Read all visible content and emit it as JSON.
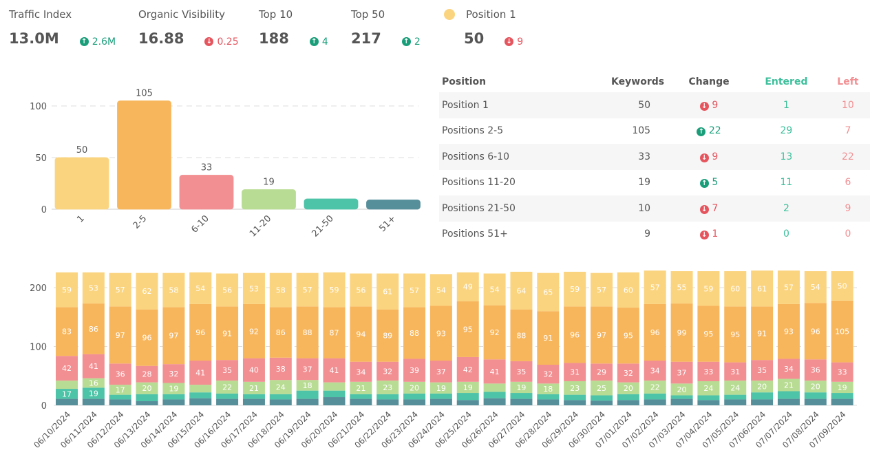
{
  "kpis": [
    {
      "label": "Traffic Index",
      "value": "13.0M",
      "change": "2.6M",
      "dir": "up"
    },
    {
      "label": "Organic Visibility",
      "value": "16.88",
      "change": "0.25",
      "dir": "down"
    },
    {
      "label": "Top 10",
      "value": "188",
      "change": "4",
      "dir": "up"
    },
    {
      "label": "Top 50",
      "value": "217",
      "change": "2",
      "dir": "up"
    },
    {
      "label": "Position 1",
      "value": "50",
      "change": "9",
      "dir": "down",
      "legend_color": "#fbd47f"
    }
  ],
  "table": {
    "headers": [
      "Position",
      "Keywords",
      "Change",
      "Entered",
      "Left"
    ],
    "rows": [
      {
        "position": "Position 1",
        "keywords": "50",
        "change": "9",
        "dir": "down",
        "entered": "1",
        "left": "10"
      },
      {
        "position": "Positions 2-5",
        "keywords": "105",
        "change": "22",
        "dir": "up",
        "entered": "29",
        "left": "7"
      },
      {
        "position": "Positions 6-10",
        "keywords": "33",
        "change": "9",
        "dir": "down",
        "entered": "13",
        "left": "22"
      },
      {
        "position": "Positions 11-20",
        "keywords": "19",
        "change": "5",
        "dir": "up",
        "entered": "11",
        "left": "6"
      },
      {
        "position": "Positions 21-50",
        "keywords": "10",
        "change": "7",
        "dir": "down",
        "entered": "2",
        "left": "9"
      },
      {
        "position": "Positions 51+",
        "keywords": "9",
        "change": "1",
        "dir": "down",
        "entered": "0",
        "left": "0"
      }
    ]
  },
  "chart_data": [
    {
      "type": "bar",
      "categories": [
        "1",
        "2-5",
        "6-10",
        "11-20",
        "21-50",
        "51+"
      ],
      "values": [
        50,
        105,
        33,
        19,
        10,
        9
      ],
      "colors": [
        "#fbd47f",
        "#f8b65c",
        "#f28f92",
        "#b9dc94",
        "#4dc3a7",
        "#568e9a"
      ],
      "ylim": [
        0,
        110
      ],
      "yticks": [
        0,
        50,
        100
      ],
      "grid": true,
      "title": "",
      "xlabel": "",
      "ylabel": ""
    },
    {
      "type": "bar",
      "stacked": true,
      "categories": [
        "06/10/2024",
        "06/11/2024",
        "06/12/2024",
        "06/13/2024",
        "06/14/2024",
        "06/15/2024",
        "06/16/2024",
        "06/17/2024",
        "06/18/2024",
        "06/19/2024",
        "06/20/2024",
        "06/21/2024",
        "06/22/2024",
        "06/23/2024",
        "06/24/2024",
        "06/25/2024",
        "06/26/2024",
        "06/27/2024",
        "06/28/2024",
        "06/29/2024",
        "06/30/2024",
        "07/01/2024",
        "07/02/2024",
        "07/03/2024",
        "07/04/2024",
        "07/05/2024",
        "07/06/2024",
        "07/07/2024",
        "07/08/2024",
        "07/09/2024"
      ],
      "series": [
        {
          "name": "51+",
          "color": "#568e9a",
          "values": [
            11,
            11,
            10,
            7,
            10,
            12,
            11,
            11,
            10,
            11,
            14,
            11,
            10,
            10,
            11,
            9,
            12,
            11,
            10,
            9,
            8,
            9,
            10,
            11,
            9,
            10,
            10,
            11,
            11,
            11
          ]
        },
        {
          "name": "21-50",
          "color": "#4dc3a7",
          "values": [
            17,
            19,
            8,
            12,
            9,
            10,
            9,
            8,
            9,
            14,
            11,
            8,
            9,
            10,
            9,
            12,
            11,
            10,
            9,
            9,
            9,
            10,
            10,
            6,
            8,
            8,
            12,
            13,
            11,
            10
          ]
        },
        {
          "name": "11-20",
          "color": "#b9dc94",
          "values": [
            14,
            16,
            17,
            20,
            19,
            13,
            22,
            21,
            24,
            18,
            14,
            21,
            23,
            20,
            19,
            19,
            14,
            19,
            18,
            23,
            25,
            20,
            22,
            20,
            24,
            24,
            20,
            21,
            20,
            19
          ]
        },
        {
          "name": "6-10",
          "color": "#f28f92",
          "values": [
            42,
            41,
            36,
            28,
            32,
            41,
            35,
            40,
            38,
            37,
            41,
            34,
            32,
            39,
            37,
            42,
            41,
            35,
            32,
            31,
            29,
            32,
            34,
            37,
            33,
            31,
            35,
            34,
            36,
            33
          ]
        },
        {
          "name": "2-5",
          "color": "#f8b65c",
          "values": [
            83,
            86,
            97,
            96,
            97,
            96,
            91,
            92,
            86,
            88,
            87,
            94,
            89,
            88,
            93,
            95,
            92,
            88,
            91,
            96,
            97,
            95,
            96,
            99,
            95,
            95,
            91,
            93,
            96,
            105
          ]
        },
        {
          "name": "1",
          "color": "#fbd47f",
          "values": [
            59,
            53,
            57,
            62,
            58,
            54,
            56,
            53,
            58,
            57,
            59,
            56,
            61,
            57,
            54,
            49,
            54,
            64,
            65,
            59,
            57,
            60,
            57,
            55,
            59,
            60,
            61,
            57,
            54,
            50
          ]
        }
      ],
      "label_min": 15,
      "ylim": [
        0,
        230
      ],
      "yticks": [
        0,
        100,
        200
      ],
      "grid": true
    }
  ]
}
